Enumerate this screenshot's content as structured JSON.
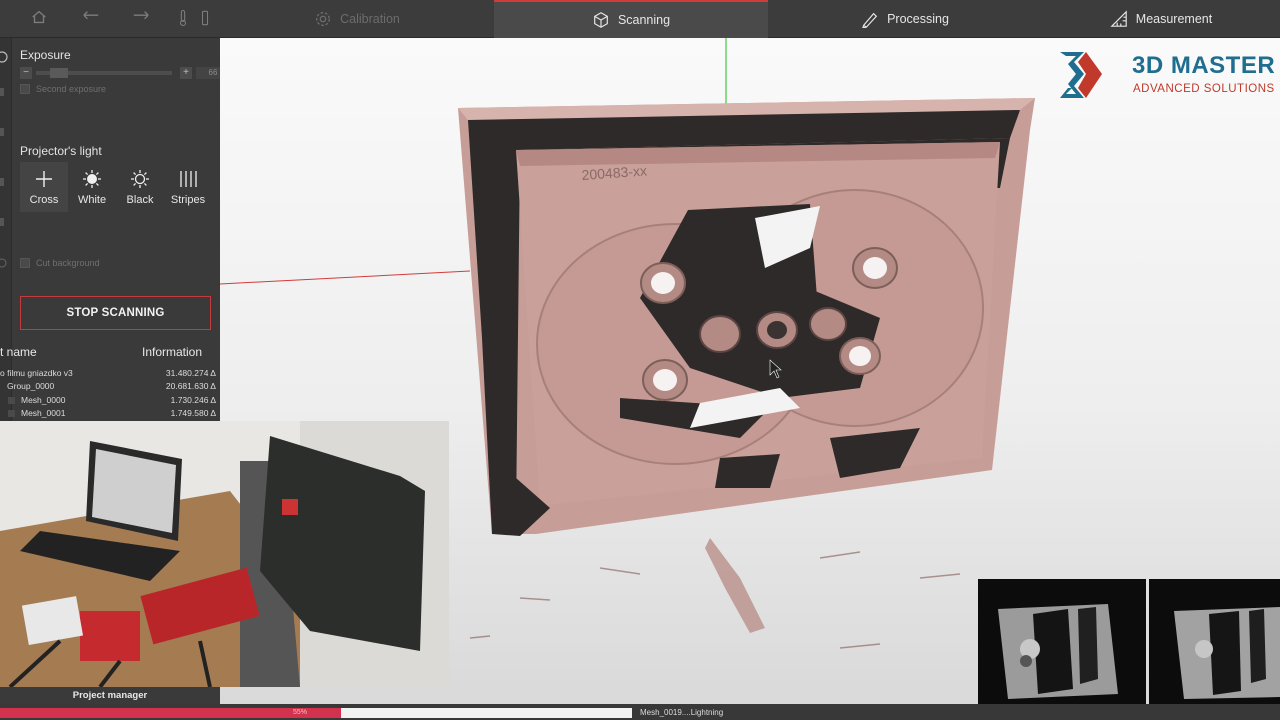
{
  "topbar": {
    "tabs": [
      {
        "label": "Calibration",
        "icon": "gear-icon",
        "state": "disabled"
      },
      {
        "label": "Scanning",
        "icon": "cube-icon",
        "state": "active"
      },
      {
        "label": "Processing",
        "icon": "pencil-ruler-icon",
        "state": "normal"
      },
      {
        "label": "Measurement",
        "icon": "triangle-ruler-icon",
        "state": "normal"
      }
    ],
    "toolbar_icons": [
      "home-icon",
      "undo-icon",
      "redo-icon",
      "thermometer-icon",
      "battery-icon"
    ]
  },
  "left_panel": {
    "exposure": {
      "title": "Exposure",
      "value": "66",
      "second_exposure_label": "Second exposure",
      "level": 0.12
    },
    "projector": {
      "title": "Projector's light",
      "options": [
        {
          "label": "Cross",
          "icon": "cross-icon",
          "selected": true
        },
        {
          "label": "White",
          "icon": "sun-filled-icon",
          "selected": false
        },
        {
          "label": "Black",
          "icon": "sun-outline-icon",
          "selected": false
        },
        {
          "label": "Stripes",
          "icon": "stripes-icon",
          "selected": false
        }
      ]
    },
    "cut_background_label": "Cut background",
    "stop_button": "STOP SCANNING",
    "tree": {
      "col_name": "t name",
      "col_info": "Information",
      "rows": [
        {
          "name": "o filmu gniazdko v3",
          "info": "31.480.274 Δ"
        },
        {
          "name": "Group_0000",
          "info": "20.681.630 Δ"
        },
        {
          "name": "Mesh_0000",
          "info": "1.730.246 Δ"
        },
        {
          "name": "Mesh_0001",
          "info": "1.749.580 Δ"
        }
      ]
    },
    "project_manager_label": "Project manager"
  },
  "viewport": {
    "logo": {
      "line1": "3D MASTER",
      "line2": "ADVANCED SOLUTIONS"
    },
    "scan_text": "200483-xx"
  },
  "status": {
    "progress_percent": 55,
    "progress_text": "55%",
    "message": "Mesh_0019....Lightning"
  },
  "colors": {
    "accent": "#d2324d",
    "brand_blue": "#1f6d8f",
    "brand_red": "#c0392b",
    "scan_surface": "#c9a09a"
  }
}
